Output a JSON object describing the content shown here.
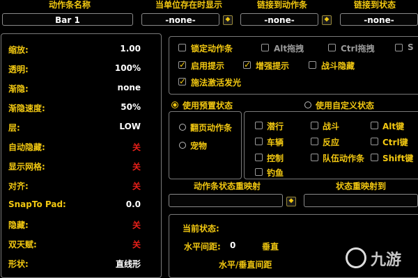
{
  "top": {
    "bar_name_header": "动作条名称",
    "bar_name_value": "Bar 1",
    "unit_header": "当单位存在时显示",
    "unit_value": "-none-",
    "link_bar_header": "链接到动作条",
    "link_bar_value": "-none-",
    "link_state_header": "链接到状态",
    "link_state_value": "-none-",
    "dropdown_glyph": "◆"
  },
  "settings": [
    {
      "label": "缩放:",
      "value": "1.00",
      "red": false
    },
    {
      "label": "透明:",
      "value": "100%",
      "red": false
    },
    {
      "label": "渐隐:",
      "value": "none",
      "red": false
    },
    {
      "label": "渐隐速度:",
      "value": "50%",
      "red": false
    },
    {
      "label": "层:",
      "value": "LOW",
      "red": false
    },
    {
      "label": "自动隐藏:",
      "value": "关",
      "red": true
    },
    {
      "label": "显示网格:",
      "value": "关",
      "red": true
    },
    {
      "label": "对齐:",
      "value": "关",
      "red": true
    },
    {
      "label": "SnapTo Pad:",
      "value": "0.0",
      "red": false
    },
    {
      "label": "隐藏:",
      "value": "关",
      "red": true
    },
    {
      "label": "双天赋:",
      "value": "关",
      "red": true
    },
    {
      "label": "形状:",
      "value": "直线形",
      "red": false
    }
  ],
  "options": {
    "lock_bar": "锁定动作条",
    "alt_drag": "Alt拖拽",
    "ctrl_drag": "Ctrl拖拽",
    "s_cut": "S",
    "enable_tips": "启用提示",
    "enhanced_tips": "增强提示",
    "combat_hide": "战斗隐藏",
    "cast_glow": "施法激活发光",
    "check_glyph": "✓"
  },
  "state": {
    "preset_label": "使用预置状态",
    "custom_label": "使用自定义状态",
    "paging_label": "翻页动作条",
    "pet_label": "宠物",
    "grid": [
      [
        "潜行",
        "战斗",
        "Alt键"
      ],
      [
        "车辆",
        "反应",
        "Ctrl键"
      ],
      [
        "控制",
        "队伍动作条",
        "Shift键"
      ],
      [
        "钓鱼",
        "",
        ""
      ]
    ]
  },
  "remap": {
    "state_remap_header": "动作条状态重映射",
    "remap_to_header": "状态重映射到"
  },
  "bottom": {
    "current_state": "当前状态:",
    "h_spacing_label": "水平间距:",
    "h_spacing_value": "0",
    "v_cut": "垂直",
    "hv_spacing": "水平/垂直间距"
  },
  "watermark": {
    "text": "九游"
  }
}
